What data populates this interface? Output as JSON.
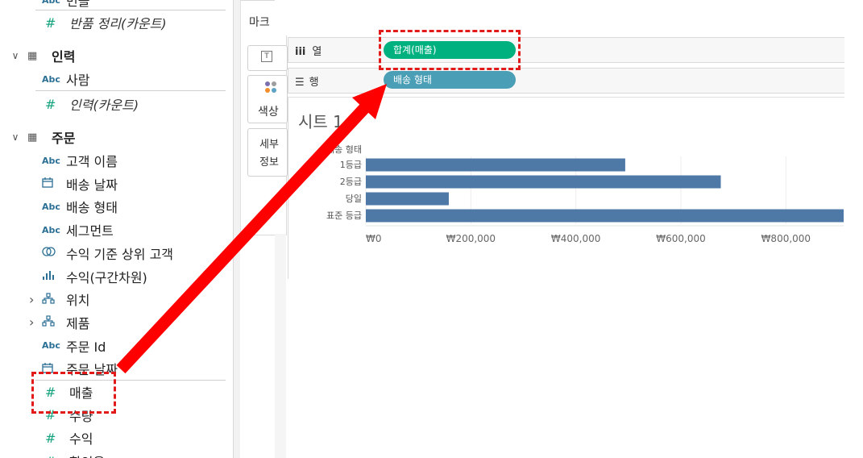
{
  "data_pane": {
    "top_partial": {
      "type": "Abc",
      "label": "번들"
    },
    "row_returns": {
      "type": "#",
      "label": "반품 정리(카운트)"
    },
    "group_people": {
      "label": "인력"
    },
    "row_person": {
      "type": "Abc",
      "label": "사람"
    },
    "row_people_count": {
      "type": "#",
      "label": "인력(카운트)"
    },
    "group_orders": {
      "label": "주문"
    },
    "fields": [
      {
        "type": "Abc",
        "label": "고객 이름"
      },
      {
        "type": "date",
        "label": "배송 날짜"
      },
      {
        "type": "Abc",
        "label": "배송 형태"
      },
      {
        "type": "Abc",
        "label": "세그먼트"
      },
      {
        "type": "set",
        "label": "수익 기준 상위 고객"
      },
      {
        "type": "bin",
        "label": "수익(구간차원)"
      },
      {
        "type": "geo",
        "label": "위치"
      },
      {
        "type": "geo",
        "label": "제품"
      },
      {
        "type": "Abc",
        "label": "주문 Id"
      },
      {
        "type": "date",
        "label": "주문 날짜"
      },
      {
        "type": "#",
        "label": "매출"
      },
      {
        "type": "#",
        "label": "수량"
      },
      {
        "type": "#",
        "label": "수익"
      },
      {
        "type": "#",
        "label": "할인율"
      }
    ]
  },
  "marks": {
    "title": "마크",
    "text_icon": "T",
    "color_label": "색상",
    "detail_label_1": "세부",
    "detail_label_2": "정보"
  },
  "shelves": {
    "columns": {
      "icon": "iii",
      "label": "열",
      "pill": "합계(매출)",
      "pill_color": "#00b180"
    },
    "rows": {
      "icon": "☰",
      "label": "행",
      "pill": "배송 형태",
      "pill_color": "#4a9eb5"
    }
  },
  "sheet_title": "시트 1",
  "row_header": "배송 형태",
  "chart_data": {
    "type": "bar",
    "orientation": "horizontal",
    "categories": [
      "1등급",
      "2등급",
      "당일",
      "표준 등급"
    ],
    "values": [
      494000,
      676000,
      158000,
      1000000
    ],
    "xlim": [
      0,
      910000
    ],
    "xticks": [
      0,
      200000,
      400000,
      600000,
      800000
    ],
    "xtick_labels": [
      "₩0",
      "₩200,000",
      "₩400,000",
      "₩600,000",
      "₩800,000"
    ],
    "bar_color": "#4e79a7",
    "grid": true
  },
  "annotation": {
    "color": "#e31a1a"
  }
}
